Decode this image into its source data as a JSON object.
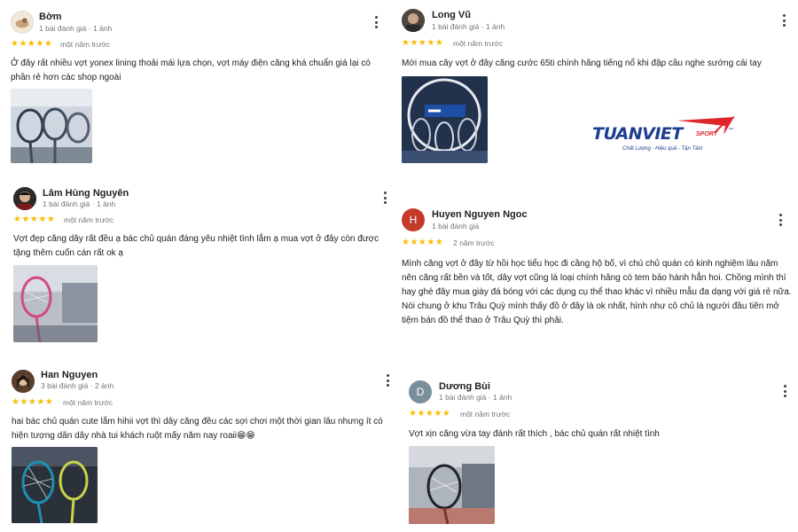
{
  "reviews": [
    {
      "name": "Bờm",
      "meta": "1 bài đánh giá · 1 ảnh",
      "stars": "★★★★★",
      "when": "một năm trước",
      "text": "Ở đây rất nhiều vợt yonex lining thoải mái lựa chọn, vợt máy điện căng khá chuẩn giá lại có phần rẻ hơn các shop ngoài"
    },
    {
      "name": "Long Vũ",
      "meta": "1 bài đánh giá · 1 ảnh",
      "stars": "★★★★★",
      "when": "một năm trước",
      "text": "Mới mua cây vợt ở đây căng cước 65ti chính hãng tiếng nổ khi đập cầu nghe sướng cái tay"
    },
    {
      "name": "Lâm Hùng Nguyên",
      "meta": "1 bài đánh giá · 1 ảnh",
      "stars": "★★★★★",
      "when": "một năm trước",
      "text": "Vợt đẹp căng dây rất đều ạ bác chủ quán đáng yêu nhiệt tình lắm ạ mua vợt ở đây còn được tặng thêm cuốn cán rất ok ạ"
    },
    {
      "name": "Huyen Nguyen Ngoc",
      "avatar_letter": "H",
      "meta": "1 bài đánh giá",
      "stars": "★★★★★",
      "when": "2 năm trước",
      "text": "Mình căng vợt ở đây từ hồi học tiểu học đi cầng hộ bố, vì chú chủ quán có kinh nghiệm lâu năm nên căng rất bền và tốt, dây vợt cũng là loại chính hãng có tem bảo hành hẳn hoi. Chồng mình thì hay ghé đây mua giày đá bóng với các dụng cụ thể thao khác vì nhiều mẫu đa dạng với giá rẻ nữa. Nói chung ở khu Trâu Quỳ mình thấy đồ ở đây là ok nhất, hình như cô chủ là người đầu tiên mở tiệm bán đồ thể thao ở Trâu Quỳ thì phải."
    },
    {
      "name": "Han Nguyen",
      "meta": "3 bài đánh giá · 2 ảnh",
      "stars": "★★★★★",
      "when": "một năm trước",
      "text": "hai bác chủ quán cute lắm hihii vợt thì dây căng đều các sợi chơi một thời gian lâu nhưng ít có hiện tượng dãn dây nhà tui khách ruột mấy năm nay roaii😁😁"
    },
    {
      "name": "Dương Bùi",
      "avatar_letter": "D",
      "meta": "1 bài đánh giá · 1 ảnh",
      "stars": "★★★★★",
      "when": "một năm trước",
      "text": "Vợt xịn căng vừa tay đánh rất thích , bác chủ quán rất nhiệt tình"
    }
  ],
  "logo": {
    "brand": "TUANVIET",
    "sub": "SPORT",
    "tm": "™",
    "tagline": "Chất Lượng - Hiệu quả - Tận Tâm"
  },
  "colors": {
    "star": "#fbbc04",
    "avatar_h": "#c5392a",
    "avatar_d": "#78909c",
    "logo_blue": "#1c3f8f",
    "logo_red": "#e0262b"
  }
}
